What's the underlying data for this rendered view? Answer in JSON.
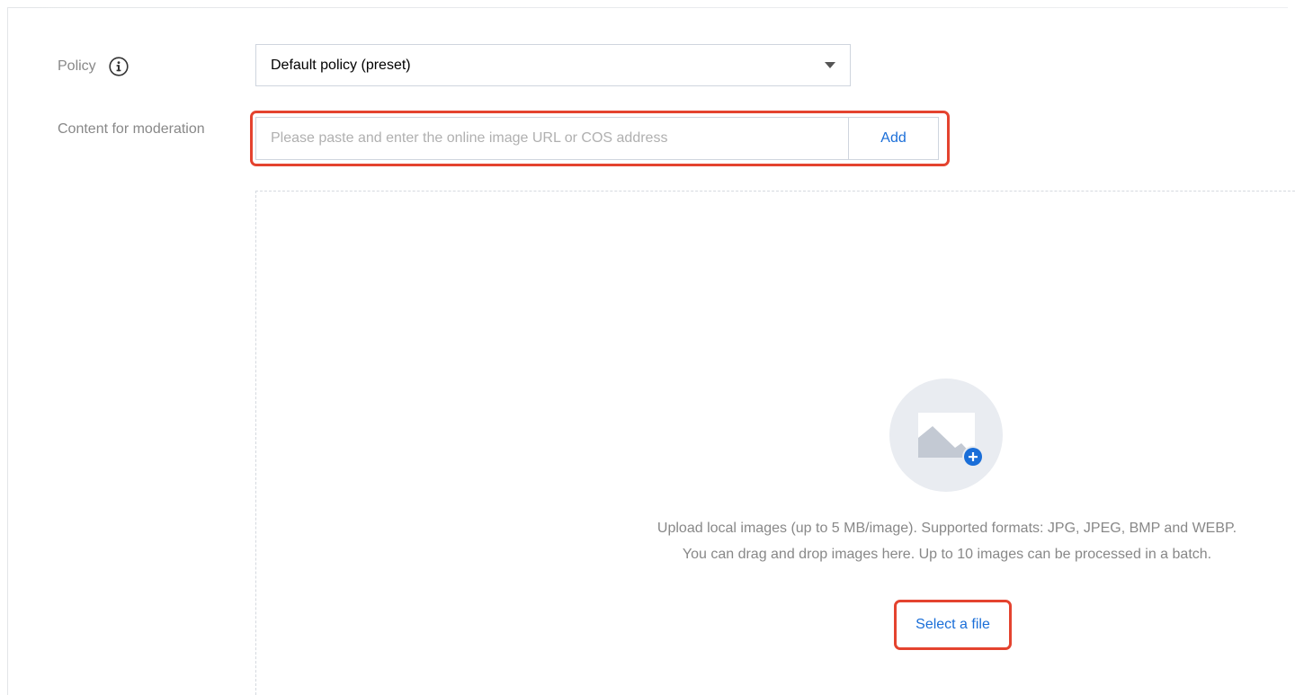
{
  "form": {
    "policy": {
      "label": "Policy",
      "info_icon": "info-icon",
      "selected": "Default policy (preset)"
    },
    "content": {
      "label": "Content for moderation",
      "url_placeholder": "Please paste and enter the online image URL or COS address",
      "url_value": "",
      "add_label": "Add"
    },
    "upload": {
      "icon": "image-add-icon",
      "description": "Upload local images (up to 5 MB/image). Supported formats: JPG, JPEG, BMP and WEBP. You can drag and drop images here. Up to 10 images can be processed in a batch.",
      "select_label": "Select a file"
    }
  },
  "colors": {
    "accent": "#1a6ed8",
    "highlight": "#e4432f",
    "label": "#888888",
    "border": "#cfd5de"
  }
}
